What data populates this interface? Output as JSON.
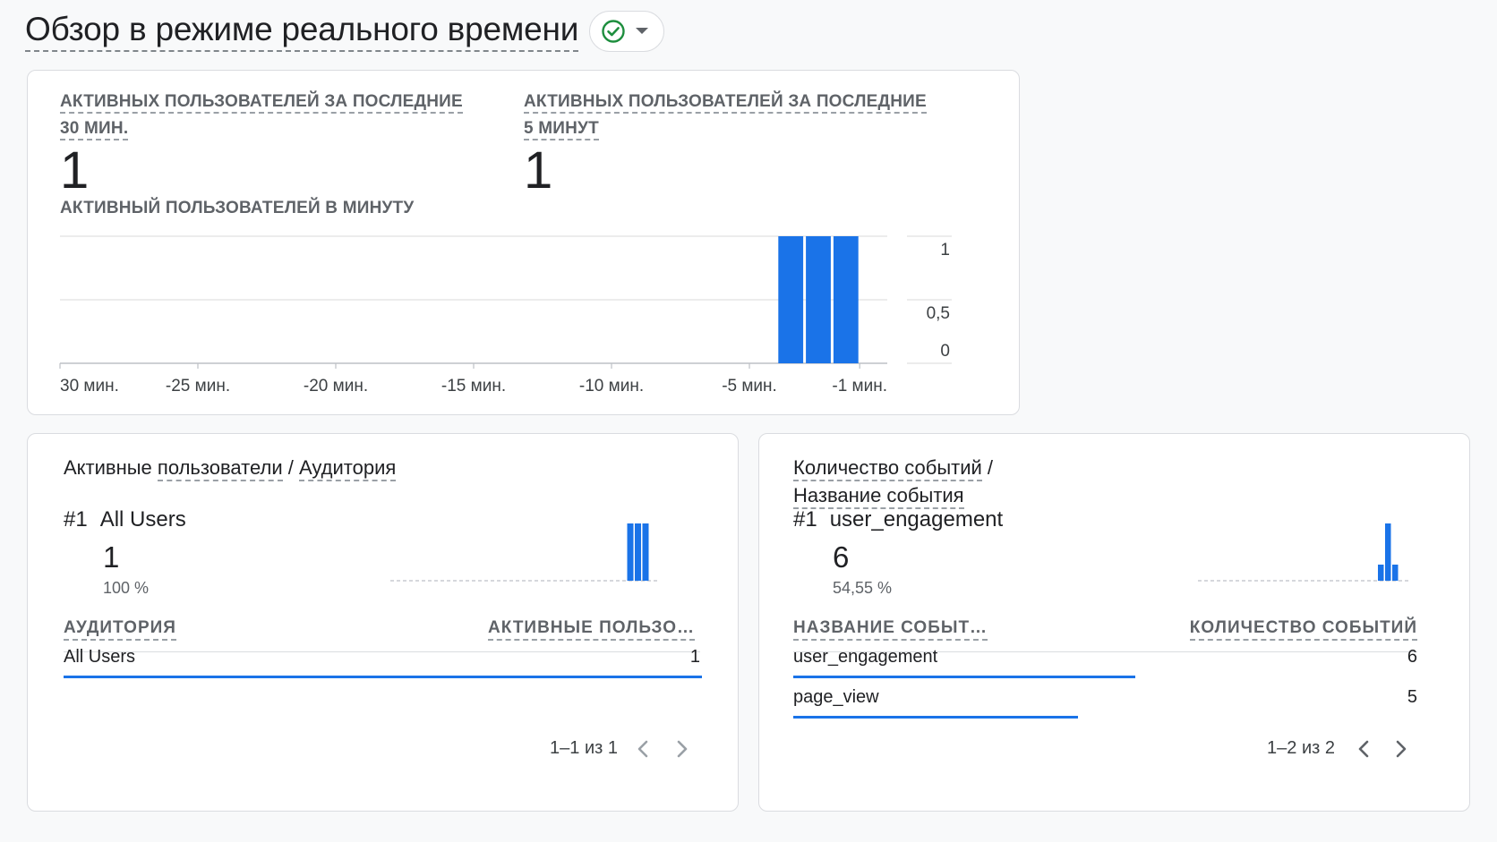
{
  "header": {
    "title": "Обзор в режиме реального времени",
    "status_icon": "check-circle-icon",
    "dropdown_icon": "caret-down-icon",
    "status_color": "#1e8e3e"
  },
  "realtime": {
    "metric_30min": {
      "label_line1": "АКТИВНЫХ ПОЛЬЗОВАТЕЛЕЙ ЗА ПОСЛЕДНИЕ",
      "label_line2": "30 МИН.",
      "value": "1"
    },
    "metric_5min": {
      "label_line1": "АКТИВНЫХ ПОЛЬЗОВАТЕЛЕЙ ЗА ПОСЛЕДНИЕ",
      "label_line2": "5 МИНУТ",
      "value": "1"
    },
    "per_minute_label": "АКТИВНЫЙ ПОЛЬЗОВАТЕЛЕЙ В МИНУТУ"
  },
  "chart_data": {
    "type": "bar",
    "title": "АКТИВНЫЙ ПОЛЬЗОВАТЕЛЕЙ В МИНУТУ",
    "x_tick_labels": [
      "30 мин.",
      "-25 мин.",
      "-20 мин.",
      "-15 мин.",
      "-10 мин.",
      "-5 мин.",
      "-1 мин."
    ],
    "y_tick_labels": [
      "1",
      "0,5",
      "0"
    ],
    "ylim": [
      0,
      1
    ],
    "bars": [
      {
        "minutes_ago": 4,
        "value": 1
      },
      {
        "minutes_ago": 3,
        "value": 1
      },
      {
        "minutes_ago": 2,
        "value": 1
      }
    ],
    "bar_color": "#1a73e8"
  },
  "audience_card": {
    "heading_part1": "Активные",
    "heading_part2": "пользователи",
    "heading_sep": " / ",
    "heading_part3": "Аудитория",
    "top_rank": "#1",
    "top_name": "All Users",
    "top_value": "1",
    "top_pct": "100 %",
    "col_name": "АУДИТОРИЯ",
    "col_value": "АКТИВНЫЕ ПОЛЬЗО…",
    "rows": [
      {
        "name": "All Users",
        "value": "1",
        "share": 1.0
      }
    ],
    "pager": "1–1 из 1"
  },
  "events_card": {
    "heading_line1": "Количество событий",
    "heading_sep": " /",
    "heading_line2": "Название события",
    "top_rank": "#1",
    "top_name": "user_engagement",
    "top_value": "6",
    "top_pct": "54,55 %",
    "col_name": "НАЗВАНИЕ СОБЫТ…",
    "col_value": "КОЛИЧЕСТВО СОБЫТИЙ",
    "rows": [
      {
        "name": "user_engagement",
        "value": "6",
        "share": 0.5455
      },
      {
        "name": "page_view",
        "value": "5",
        "share": 0.4545
      }
    ],
    "pager": "1–2 из 2"
  },
  "pager_icons": {
    "prev": "chevron-left-icon",
    "next": "chevron-right-icon"
  }
}
